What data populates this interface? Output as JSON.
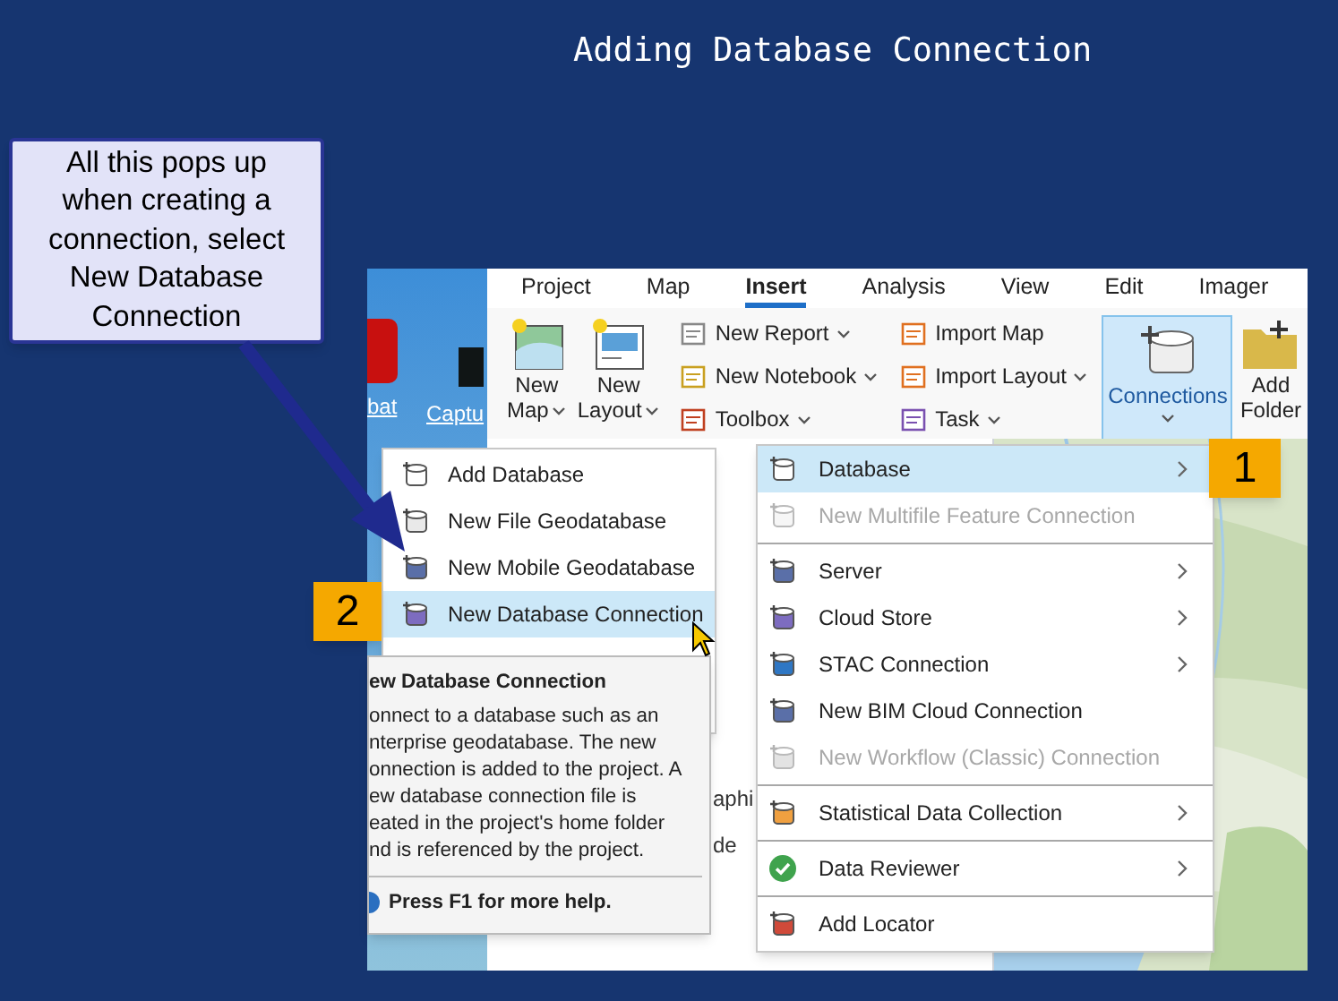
{
  "slide": {
    "title": "Adding Database Connection",
    "callout": "All this pops up when creating a connection, select New Database Connection",
    "badges": [
      "1",
      "2"
    ]
  },
  "desktop": {
    "labels": [
      "bat",
      "Captu"
    ]
  },
  "ribbon": {
    "tabs": [
      {
        "label": "Project",
        "selected": false
      },
      {
        "label": "Map",
        "selected": false
      },
      {
        "label": "Insert",
        "selected": true
      },
      {
        "label": "Analysis",
        "selected": false
      },
      {
        "label": "View",
        "selected": false
      },
      {
        "label": "Edit",
        "selected": false
      },
      {
        "label": "Imager",
        "selected": false
      }
    ],
    "large_buttons": [
      {
        "label": [
          "New",
          "Map"
        ]
      },
      {
        "label": [
          "New",
          "Layout"
        ]
      }
    ],
    "small_columns": [
      [
        {
          "label": "New Report"
        },
        {
          "label": "New Notebook"
        },
        {
          "label": "Toolbox"
        }
      ],
      [
        {
          "label": "Import Map"
        },
        {
          "label": "Import Layout"
        },
        {
          "label": "Task"
        }
      ]
    ],
    "connections": {
      "label": "Connections",
      "selected": true
    },
    "add_folder": {
      "label": [
        "Add",
        "Folder"
      ]
    }
  },
  "background_fragments": [
    "aphi",
    "de"
  ],
  "database_menu": [
    {
      "label": "Add Database",
      "selected": false
    },
    {
      "label": "New File Geodatabase",
      "selected": false
    },
    {
      "label": "New Mobile Geodatabase",
      "selected": false
    },
    {
      "label": "New Database Connection",
      "selected": true
    }
  ],
  "tooltip": {
    "title": "ew Database Connection",
    "lines": [
      "onnect to a database such as an",
      "nterprise geodatabase. The new",
      "onnection is added to the project. A",
      "ew database connection file is",
      "eated in the project's home folder",
      "nd is referenced by the project."
    ],
    "help": "Press F1 for more help."
  },
  "connections_menu": [
    [
      {
        "label": "Database",
        "selected": true,
        "disabled": false,
        "submenu": true
      },
      {
        "label": "New Multifile Feature Connection",
        "selected": false,
        "disabled": true,
        "submenu": false
      }
    ],
    [
      {
        "label": "Server",
        "selected": false,
        "disabled": false,
        "submenu": true
      },
      {
        "label": "Cloud Store",
        "selected": false,
        "disabled": false,
        "submenu": true
      },
      {
        "label": "STAC Connection",
        "selected": false,
        "disabled": false,
        "submenu": true
      },
      {
        "label": "New BIM Cloud Connection",
        "selected": false,
        "disabled": false,
        "submenu": false
      },
      {
        "label": "New Workflow (Classic) Connection",
        "selected": false,
        "disabled": true,
        "submenu": false
      }
    ],
    [
      {
        "label": "Statistical Data Collection",
        "selected": false,
        "disabled": false,
        "submenu": true
      }
    ],
    [
      {
        "label": "Data Reviewer",
        "selected": false,
        "disabled": false,
        "submenu": true
      }
    ],
    [
      {
        "label": "Add Locator",
        "selected": false,
        "disabled": false,
        "submenu": false
      }
    ]
  ]
}
